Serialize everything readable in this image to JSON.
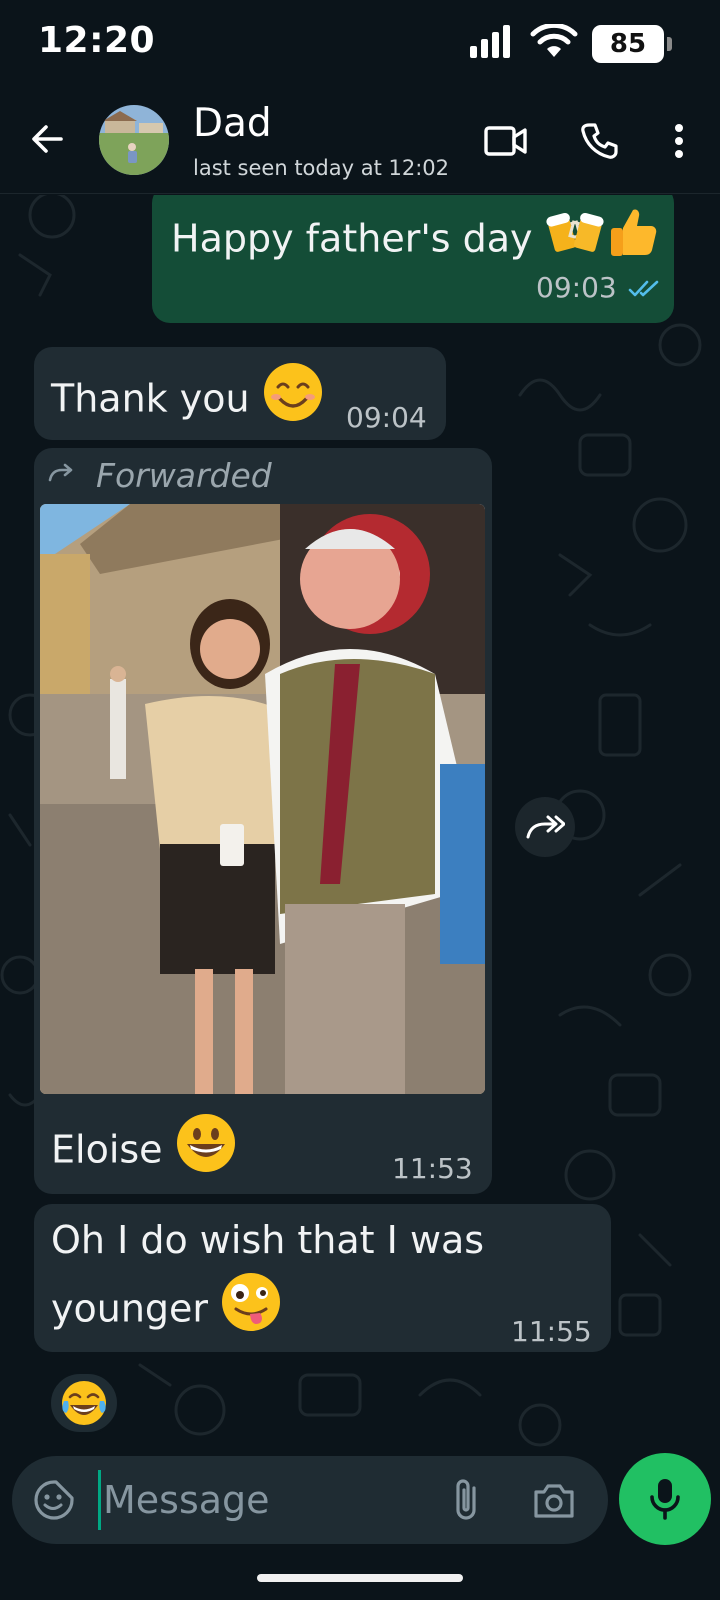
{
  "status_bar": {
    "time": "12:20",
    "battery_level": "85",
    "icons": [
      "signal-icon",
      "wifi-icon",
      "battery-icon"
    ]
  },
  "header": {
    "contact_name": "Dad",
    "last_seen": "last seen today at 12:02",
    "icons": [
      "back-arrow-icon",
      "video-call-icon",
      "phone-icon",
      "more-options-icon"
    ]
  },
  "messages": [
    {
      "direction": "outgoing",
      "text": "Happy father's day",
      "emojis": [
        "beer-mugs-emoji",
        "thumbs-up-emoji"
      ],
      "time": "09:03",
      "status": "read",
      "status_color": "#53bdeb"
    },
    {
      "direction": "incoming",
      "text": "Thank you",
      "emojis": [
        "smiling-face-emoji"
      ],
      "time": "09:04"
    },
    {
      "direction": "incoming",
      "forwarded_label": "Forwarded",
      "has_photo": true,
      "caption": "Eloise",
      "emojis": [
        "grinning-face-emoji"
      ],
      "time": "11:53"
    },
    {
      "direction": "incoming",
      "text_line1": "Oh I do wish that I was",
      "text_line2": "younger",
      "emojis": [
        "zany-face-emoji"
      ],
      "time": "11:55",
      "reaction": "tears-of-joy-emoji"
    }
  ],
  "composer": {
    "placeholder": "Message",
    "icons": [
      "sticker-icon",
      "attach-icon",
      "camera-icon",
      "mic-icon"
    ]
  },
  "colors": {
    "background": "#0b141a",
    "outgoing_bubble": "#144d37",
    "incoming_bubble": "#202c33",
    "accent": "#21c063",
    "read_ticks": "#53bdeb"
  }
}
